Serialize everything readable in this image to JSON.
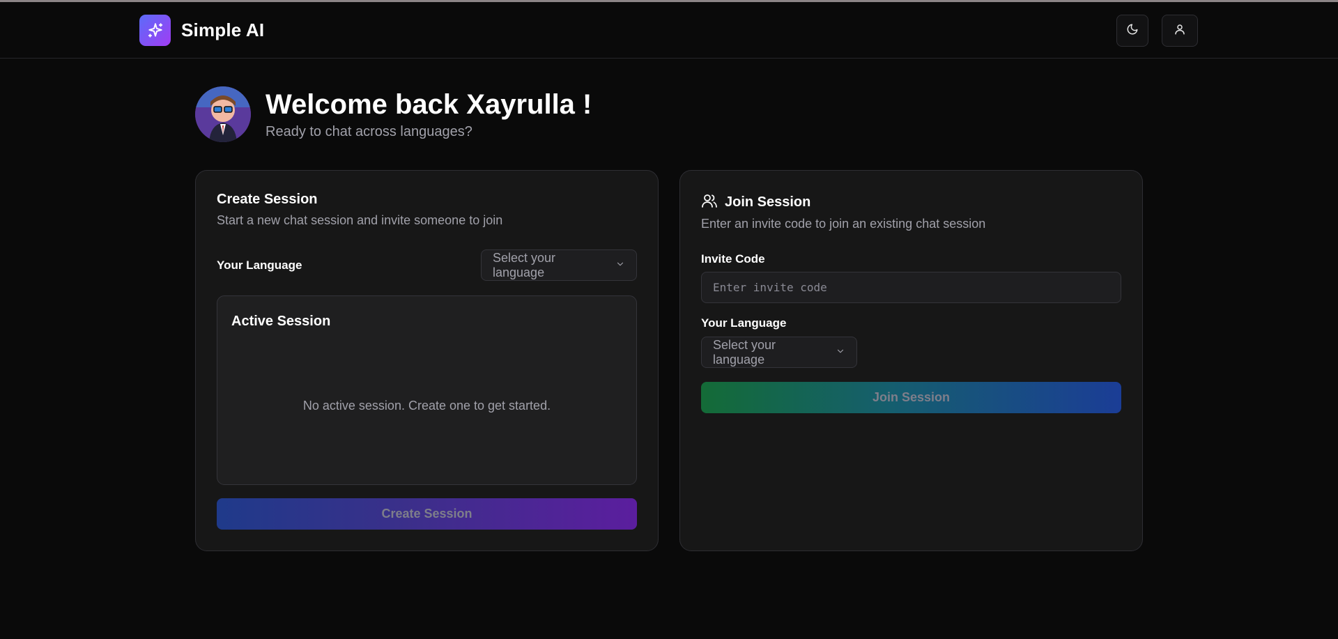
{
  "app": {
    "name": "Simple AI"
  },
  "header": {
    "theme_icon": "moon-icon",
    "user_icon": "user-icon"
  },
  "welcome": {
    "title": "Welcome back Xayrulla !",
    "subtitle": "Ready to chat across languages?"
  },
  "create_session": {
    "title": "Create Session",
    "description": "Start a new chat session and invite someone to join",
    "language_label": "Your Language",
    "language_select": "Select your language",
    "active_title": "Active Session",
    "active_empty": "No active session. Create one to get started.",
    "button": "Create Session"
  },
  "join_session": {
    "title": "Join Session",
    "description": "Enter an invite code to join an existing chat session",
    "invite_label": "Invite Code",
    "invite_placeholder": "Enter invite code",
    "language_label": "Your Language",
    "language_select": "Select your language",
    "button": "Join Session"
  },
  "colors": {
    "background": "#0a0a0a",
    "card": "#171717",
    "brand_gradient_start": "#5b6cf9",
    "brand_gradient_end": "#a13cf3"
  }
}
